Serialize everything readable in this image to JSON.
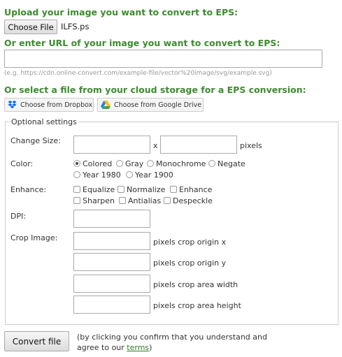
{
  "upload": {
    "heading": "Upload your image you want to convert to EPS:",
    "choose_file_label": "Choose File",
    "file_name": "ILFS.ps"
  },
  "url": {
    "heading": "Or enter URL of your image you want to convert to EPS:",
    "value": "",
    "example": "(e.g. https://cdn.online-convert.com/example-file/vector%20image/svg/example.svg)"
  },
  "cloud": {
    "heading": "Or select a file from your cloud storage for a EPS conversion:",
    "dropbox_label": "Choose from Dropbox",
    "gdrive_label": "Choose from Google Drive"
  },
  "settings": {
    "legend": "Optional settings",
    "change_size": {
      "label": "Change Size:",
      "width": "",
      "height": "",
      "separator": "x",
      "unit": "pixels"
    },
    "color": {
      "label": "Color:",
      "options": [
        "Colored",
        "Gray",
        "Monochrome",
        "Negate",
        "Year 1980",
        "Year 1900"
      ],
      "selected": "Colored"
    },
    "enhance": {
      "label": "Enhance:",
      "options": [
        "Equalize",
        "Normalize",
        "Enhance",
        "Sharpen",
        "Antialias",
        "Despeckle"
      ]
    },
    "dpi": {
      "label": "DPI:",
      "value": ""
    },
    "crop": {
      "label": "Crop Image:",
      "fields": [
        {
          "value": "",
          "label": "pixels crop origin x"
        },
        {
          "value": "",
          "label": "pixels crop origin y"
        },
        {
          "value": "",
          "label": "pixels crop area width"
        },
        {
          "value": "",
          "label": "pixels crop area height"
        }
      ]
    }
  },
  "convert": {
    "button_label": "Convert file",
    "note_line1": "(by clicking you confirm that you understand and",
    "note_line2_prefix": "agree to our ",
    "terms_label": "terms",
    "note_line2_suffix": ")"
  },
  "colors": {
    "heading_green": "#3d8b2f",
    "dropbox_blue": "#0061ff",
    "link_green": "#2e7d2e"
  },
  "icons": {
    "dropbox": "dropbox-icon",
    "google_drive": "google-drive-icon"
  }
}
